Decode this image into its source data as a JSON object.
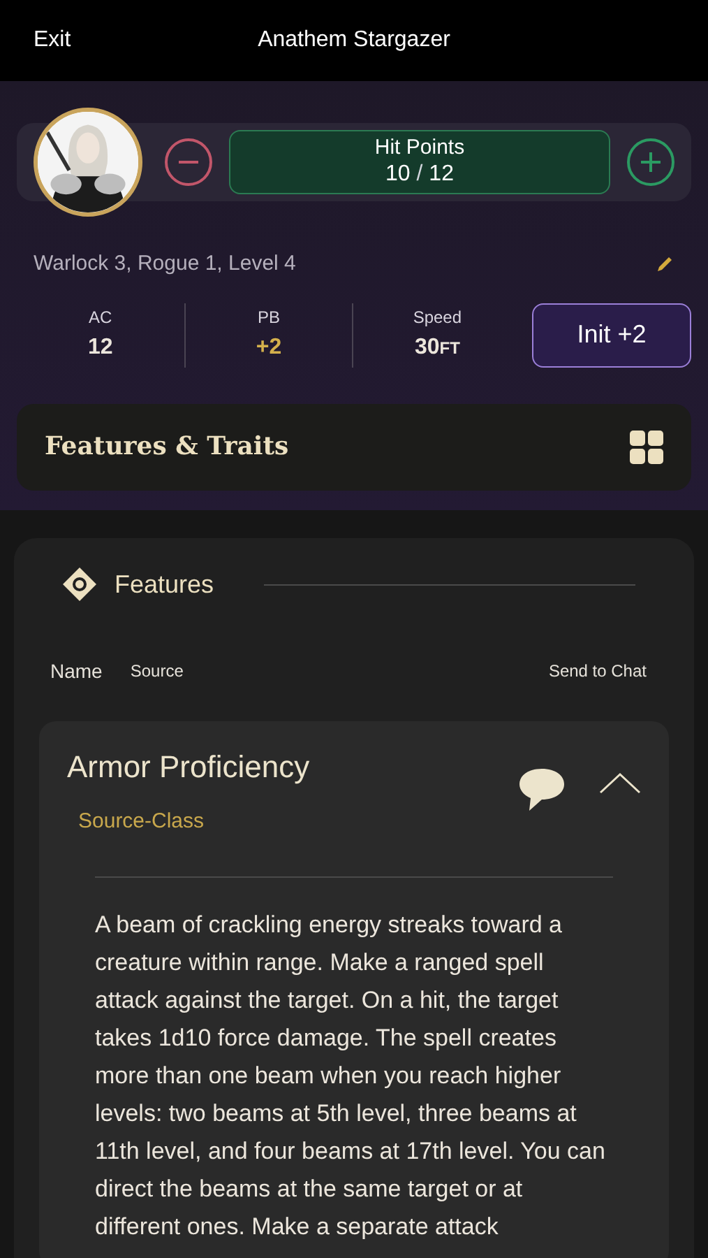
{
  "header": {
    "exit": "Exit",
    "title": "Anathem Stargazer"
  },
  "hit_points": {
    "label": "Hit Points",
    "current": "10",
    "separator": "/",
    "max": "12"
  },
  "class_line": "Warlock 3, Rogue 1, Level 4",
  "stats": [
    {
      "label": "AC",
      "value": "12",
      "accent": false
    },
    {
      "label": "PB",
      "value": "+2",
      "accent": true
    },
    {
      "label": "Speed",
      "value": "30",
      "unit": "FT",
      "accent": false
    }
  ],
  "initiative": "Init +2",
  "section_title": "Features & Traits",
  "features": {
    "heading": "Features",
    "columns": [
      "Name",
      "Source",
      "Send to Chat"
    ],
    "items": [
      {
        "name": "Armor Proficiency",
        "source": "Source-Class",
        "expanded": true,
        "description": "A beam of crackling energy streaks toward a creature within range. Make a ranged spell attack against the target. On a hit, the target takes 1d10 force damage. The spell creates more than one beam when you reach higher levels: two beams at 5th level, three beams at 11th level, and four beams at 17th level. You can direct the beams at the same target or at different ones. Make a separate attack"
      }
    ]
  }
}
